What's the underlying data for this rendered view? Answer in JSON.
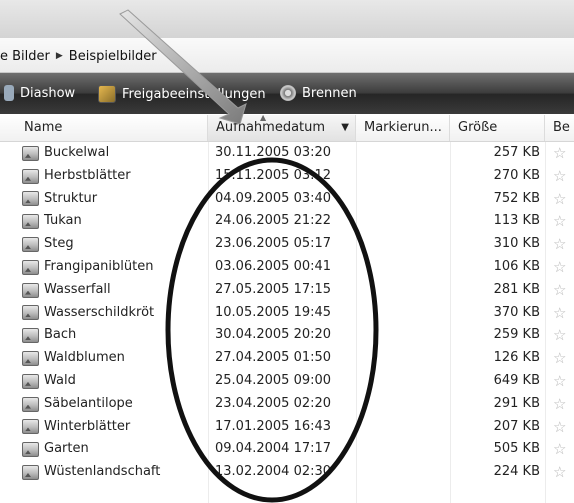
{
  "breadcrumb": {
    "parent": "e Bilder",
    "current": "Beispielbilder"
  },
  "toolbar": {
    "diashow": "Diashow",
    "freigabe": "Freigabeeinstellungen",
    "brennen": "Brennen"
  },
  "columns": {
    "name": "Name",
    "date": "Aufnahmedatum",
    "tags": "Markierun...",
    "size": "Größe",
    "rating": "Be"
  },
  "rows": [
    {
      "name": "Buckelwal",
      "date": "30.11.2005 03:20",
      "size": "257 KB"
    },
    {
      "name": "Herbstblätter",
      "date": "15.11.2005 03:12",
      "size": "270 KB"
    },
    {
      "name": "Struktur",
      "date": "04.09.2005 03:40",
      "size": "752 KB"
    },
    {
      "name": "Tukan",
      "date": "24.06.2005 21:22",
      "size": "113 KB"
    },
    {
      "name": "Steg",
      "date": "23.06.2005 05:17",
      "size": "310 KB"
    },
    {
      "name": "Frangipaniblüten",
      "date": "03.06.2005 00:41",
      "size": "106 KB"
    },
    {
      "name": "Wasserfall",
      "date": "27.05.2005 17:15",
      "size": "281 KB"
    },
    {
      "name": "Wasserschildkröt",
      "date": "10.05.2005 19:45",
      "size": "370 KB"
    },
    {
      "name": "Bach",
      "date": "30.04.2005 20:20",
      "size": "259 KB"
    },
    {
      "name": "Waldblumen",
      "date": "27.04.2005 01:50",
      "size": "126 KB"
    },
    {
      "name": "Wald",
      "date": "25.04.2005 09:00",
      "size": "649 KB"
    },
    {
      "name": "Säbelantilope",
      "date": "23.04.2005 02:20",
      "size": "291 KB"
    },
    {
      "name": "Winterblätter",
      "date": "17.01.2005 16:43",
      "size": "207 KB"
    },
    {
      "name": "Garten",
      "date": "09.04.2004 17:17",
      "size": "505 KB"
    },
    {
      "name": "Wüstenlandschaft",
      "date": "13.02.2004 02:30",
      "size": "224 KB"
    }
  ],
  "icons": {
    "star": "☆",
    "breadcrumb_separator": "▶",
    "dropdown": "▼",
    "sort": "▲"
  }
}
